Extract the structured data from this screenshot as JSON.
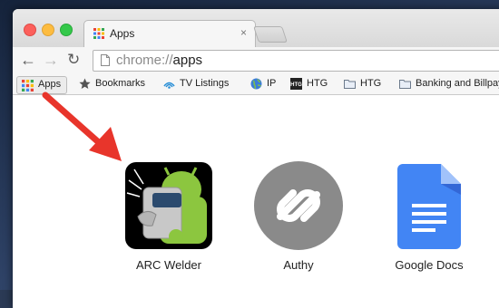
{
  "window": {
    "controls": [
      "close",
      "minimize",
      "zoom"
    ]
  },
  "tab": {
    "title": "Apps",
    "close_glyph": "×",
    "favicon": "apps-grid-icon"
  },
  "toolbar": {
    "back_glyph": "←",
    "forward_glyph": "→",
    "reload_glyph": "↻",
    "url_scheme": "chrome://",
    "url_path": "apps"
  },
  "bookmarks": {
    "items": [
      {
        "label": "Apps",
        "icon": "apps-grid-icon"
      },
      {
        "label": "Bookmarks",
        "icon": "star-icon"
      },
      {
        "label": "TV Listings",
        "icon": "tv-listings-icon"
      },
      {
        "label": "IP",
        "icon": "globe-icon"
      },
      {
        "label": "HTG",
        "icon": "htg-logo-icon"
      },
      {
        "label": "HTG",
        "icon": "folder-icon"
      },
      {
        "label": "Banking and Billpay",
        "icon": "folder-icon"
      }
    ]
  },
  "apps": [
    {
      "name": "ARC Welder",
      "icon": "arc-welder-icon"
    },
    {
      "name": "Authy",
      "icon": "authy-icon"
    },
    {
      "name": "Google Docs",
      "icon": "google-docs-icon"
    }
  ],
  "colors": {
    "annotation_arrow": "#e8352b",
    "arc_bg": "#000000",
    "arc_green": "#8cc63f",
    "authy_gray": "#8a8a8a",
    "docs_blue": "#4285f4"
  }
}
